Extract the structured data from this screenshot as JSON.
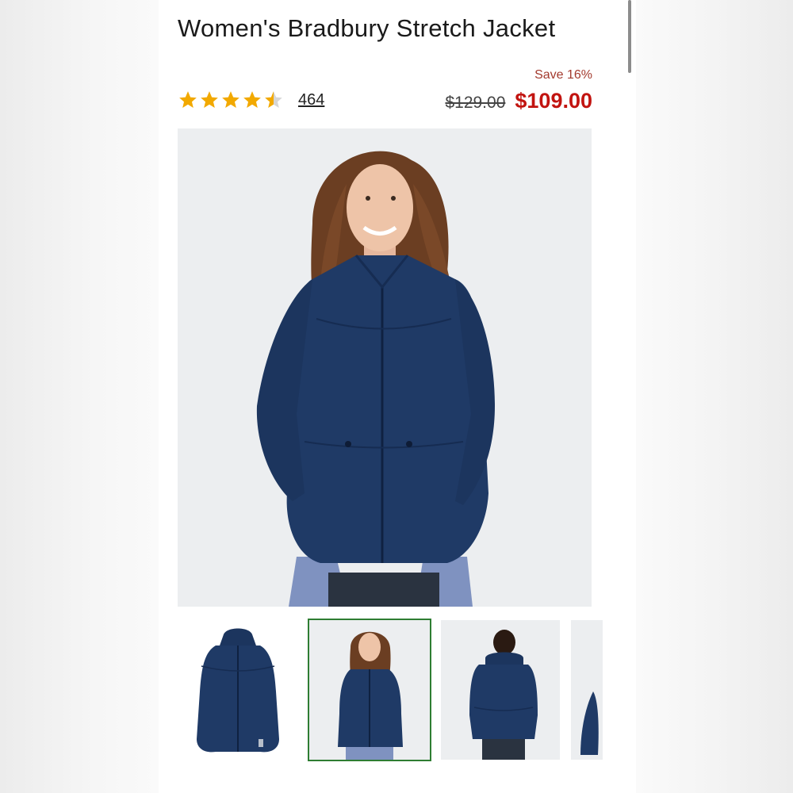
{
  "product": {
    "title": "Women's Bradbury Stretch Jacket",
    "rating": 4.5,
    "rating_max": 5,
    "review_count": "464",
    "save_text": "Save 16%",
    "original_price": "$129.00",
    "sale_price": "$109.00"
  },
  "colors": {
    "sale_price": "#c21410",
    "save_text": "#a33a2e",
    "star": "#f2a900",
    "star_empty": "#d6d6d6",
    "jacket": "#1f3a66",
    "selected_thumb_border": "#2e7d32"
  },
  "gallery": {
    "hero": {
      "description_icon": "jacket-model-front-image"
    },
    "thumbnails": [
      {
        "icon": "jacket-flat-image",
        "selected": false
      },
      {
        "icon": "jacket-model-front-image",
        "selected": true
      },
      {
        "icon": "jacket-model-back-image",
        "selected": false
      },
      {
        "icon": "jacket-model-partial-image",
        "selected": false
      }
    ]
  }
}
